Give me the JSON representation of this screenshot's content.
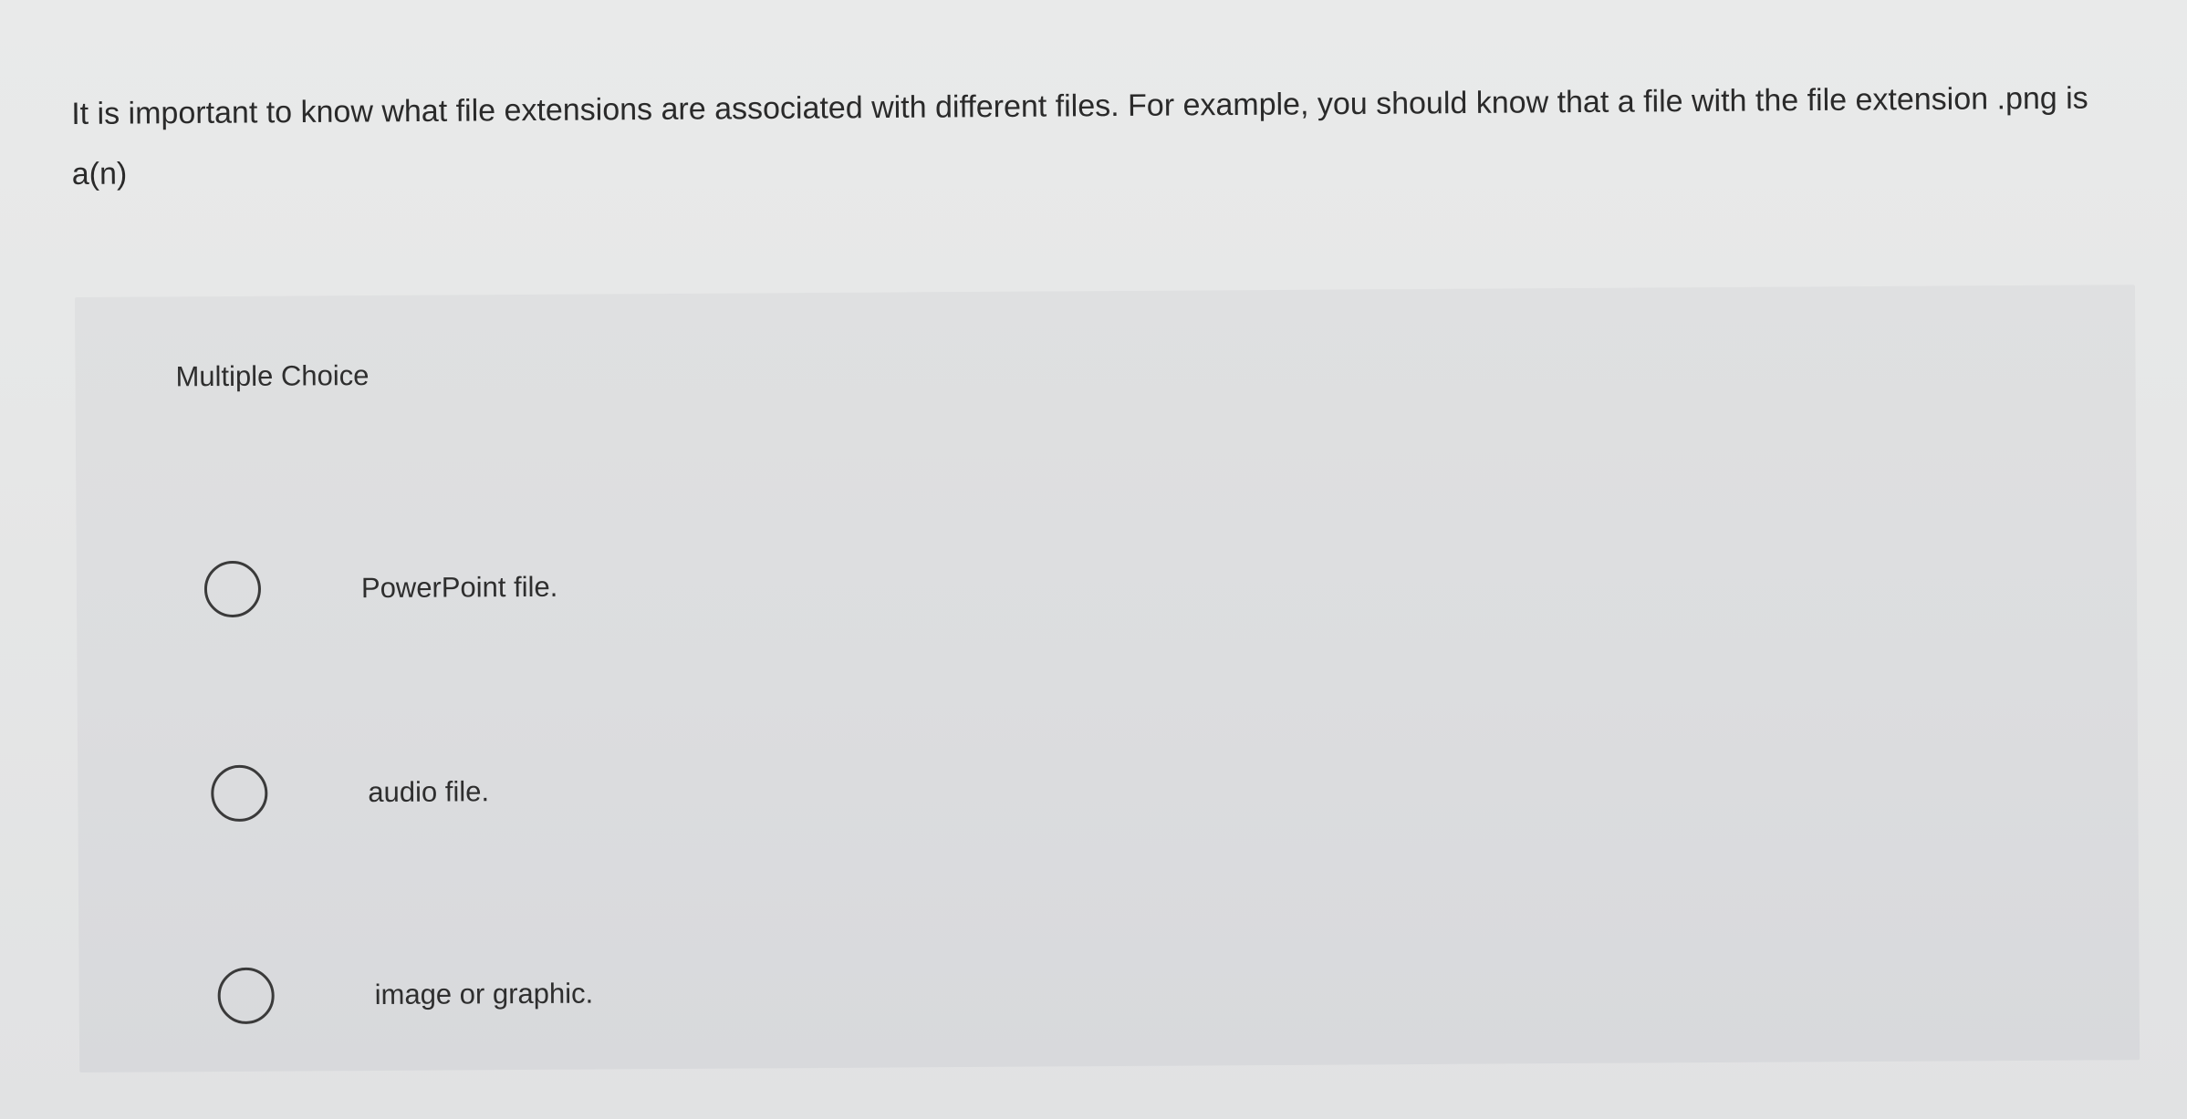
{
  "question": {
    "text": "It is important to know what file extensions are associated with different files. For example, you should know that a file with the file extension .png is a(n)"
  },
  "panel": {
    "type_label": "Multiple Choice",
    "choices": [
      {
        "label": "PowerPoint file.",
        "selected": false
      },
      {
        "label": "audio file.",
        "selected": false
      },
      {
        "label": "image or graphic.",
        "selected": false
      }
    ]
  },
  "colors": {
    "background": "#e7e8e8",
    "panel": "#dcdddf",
    "text": "#2b2b2b",
    "radio_border": "#3a3a3a"
  }
}
